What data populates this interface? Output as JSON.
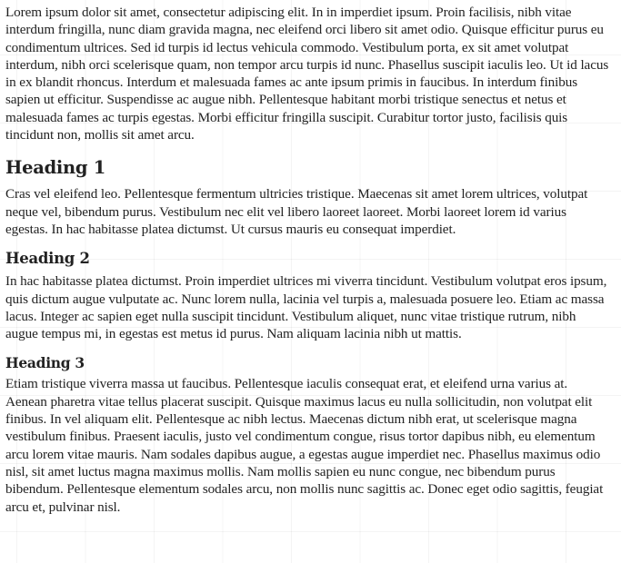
{
  "document": {
    "intro": "Lorem ipsum dolor sit amet, consectetur adipiscing elit. In in imperdiet ipsum. Proin facilisis, nibh vitae interdum fringilla, nunc diam gravida magna, nec eleifend orci libero sit amet odio. Quisque efficitur purus eu condimentum ultrices. Sed id turpis id lectus vehicula commodo. Vestibulum porta, ex sit amet volutpat interdum, nibh orci scelerisque quam, non tempor arcu turpis id nunc. Phasellus suscipit iaculis leo. Ut id lacus in ex blandit rhoncus. Interdum et malesuada fames ac ante ipsum primis in faucibus. In interdum finibus sapien ut efficitur. Suspendisse ac augue nibh. Pellentesque habitant morbi tristique senectus et netus et malesuada fames ac turpis egestas. Morbi efficitur fringilla suscipit. Curabitur tortor justo, facilisis quis tincidunt non, mollis sit amet arcu.",
    "sections": [
      {
        "heading": "Heading 1",
        "body": "Cras vel eleifend leo. Pellentesque fermentum ultricies tristique. Maecenas sit amet lorem ultrices, volutpat neque vel, bibendum purus. Vestibulum nec elit vel libero laoreet laoreet. Morbi laoreet lorem id varius egestas. In hac habitasse platea dictumst. Ut cursus mauris eu consequat imperdiet."
      },
      {
        "heading": "Heading 2",
        "body": "In hac habitasse platea dictumst. Proin imperdiet ultrices mi viverra tincidunt. Vestibulum volutpat eros ipsum, quis dictum augue vulputate ac. Nunc lorem nulla, lacinia vel turpis a, malesuada posuere leo. Etiam ac massa lacus. Integer ac sapien eget nulla suscipit tincidunt. Vestibulum aliquet, nunc vitae tristique rutrum, nibh augue tempus mi, in egestas est metus id purus. Nam aliquam lacinia nibh ut mattis."
      },
      {
        "heading": "Heading 3",
        "body": "Etiam tristique viverra massa ut faucibus. Pellentesque iaculis consequat erat, et eleifend urna varius at. Aenean pharetra vitae tellus placerat suscipit. Quisque maximus lacus eu nulla sollicitudin, non volutpat elit finibus. In vel aliquam elit. Pellentesque ac nibh lectus. Maecenas dictum nibh erat, ut scelerisque magna vestibulum finibus. Praesent iaculis, justo vel condimentum congue, risus tortor dapibus nibh, eu elementum arcu lorem vitae mauris. Nam sodales dapibus augue, a egestas augue imperdiet nec. Phasellus maximus odio nisl, sit amet luctus magna maximus mollis. Nam mollis sapien eu nunc congue, nec bibendum purus bibendum. Pellentesque elementum sodales arcu, non mollis nunc sagittis ac. Donec eget odio sagittis, feugiat arcu et, pulvinar nisl."
      }
    ]
  }
}
